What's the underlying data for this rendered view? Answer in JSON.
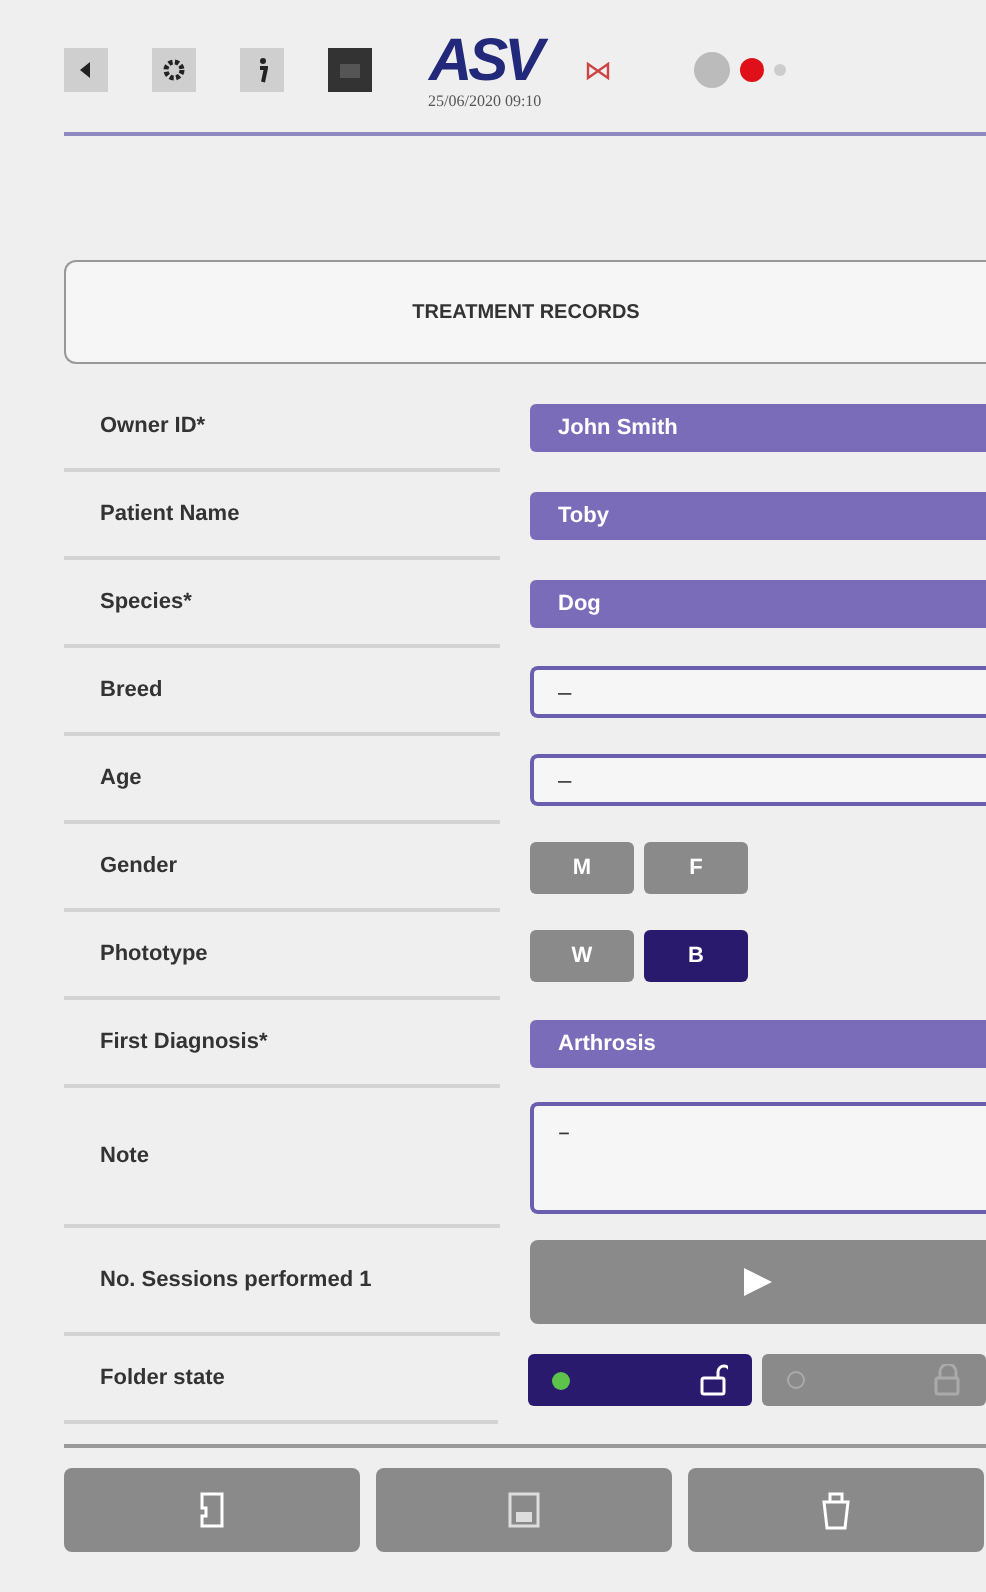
{
  "header": {
    "logo": "ASV",
    "datetime": "25/06/2020 09:10",
    "tutorial_selected": true
  },
  "title": "TREATMENT RECORDS",
  "rows": [
    {
      "label": "Owner ID*",
      "kind": "filled",
      "value": "John Smith"
    },
    {
      "label": "Patient Name",
      "kind": "filled",
      "value": "Toby"
    },
    {
      "label": "Species*",
      "kind": "filled",
      "value": "Dog"
    },
    {
      "label": "Breed",
      "kind": "input",
      "value": "–"
    },
    {
      "label": "Age",
      "kind": "input",
      "value": "–"
    },
    {
      "label": "Gender",
      "kind": "toggle",
      "options": [
        {
          "label": "M",
          "selected": false
        },
        {
          "label": "F",
          "selected": false
        }
      ]
    },
    {
      "label": "Phototype",
      "kind": "toggle",
      "options": [
        {
          "label": "W",
          "selected": false
        },
        {
          "label": "B",
          "selected": true
        }
      ]
    },
    {
      "label": "First Diagnosis*",
      "kind": "filled",
      "value": "Arthrosis"
    },
    {
      "label": "Note",
      "kind": "note",
      "value": "–"
    },
    {
      "label": "No. Sessions performed 1",
      "kind": "play"
    },
    {
      "label": "Folder state",
      "kind": "folder",
      "options": [
        {
          "locked": false,
          "selected": true
        },
        {
          "locked": true,
          "selected": false
        }
      ]
    }
  ]
}
